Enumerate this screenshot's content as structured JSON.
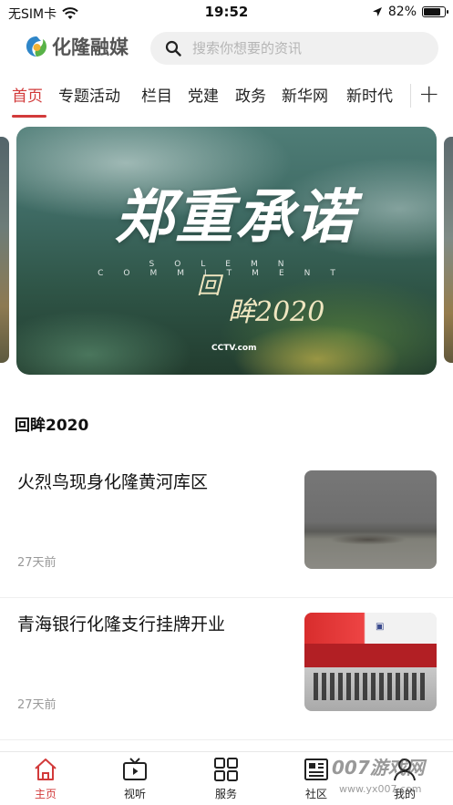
{
  "status_bar": {
    "carrier": "无SIM卡",
    "time": "19:52",
    "battery": "82%",
    "battery_level": 0.82,
    "icons": [
      "wifi-icon",
      "location-icon",
      "battery-icon"
    ]
  },
  "header": {
    "logo_text": "化隆融媒",
    "search_placeholder": "搜索你想要的资讯"
  },
  "tabs": {
    "items": [
      {
        "label": "首页",
        "active": true
      },
      {
        "label": "专题活动",
        "active": false
      },
      {
        "label": "栏目",
        "active": false
      },
      {
        "label": "党建",
        "active": false
      },
      {
        "label": "政务",
        "active": false
      },
      {
        "label": "新华网",
        "active": false
      },
      {
        "label": "新时代",
        "active": false
      }
    ],
    "add_label": "+"
  },
  "banner": {
    "title": "郑重承诺",
    "subtitle": "SOLEMN COMMITMENT",
    "mark_line1": "回",
    "mark_line2": "眸2020",
    "logo": "CCTV.com"
  },
  "section": {
    "title": "回眸2020"
  },
  "news": [
    {
      "title": "火烈鸟现身化隆黄河库区",
      "time": "27天前"
    },
    {
      "title": "青海银行化隆支行挂牌开业",
      "time": "27天前"
    }
  ],
  "bottom_nav": [
    {
      "label": "主页",
      "icon": "home-icon",
      "active": true
    },
    {
      "label": "视听",
      "icon": "tv-icon",
      "active": false
    },
    {
      "label": "服务",
      "icon": "grid-icon",
      "active": false
    },
    {
      "label": "社区",
      "icon": "newspaper-icon",
      "active": false
    },
    {
      "label": "我的",
      "icon": "user-icon",
      "active": false
    }
  ],
  "watermark": {
    "text": "007游戏网",
    "url": "www.yx007.com"
  },
  "colors": {
    "accent": "#d23a3a",
    "text": "#111111",
    "muted": "#999999",
    "search_bg": "#f0f0f0"
  }
}
